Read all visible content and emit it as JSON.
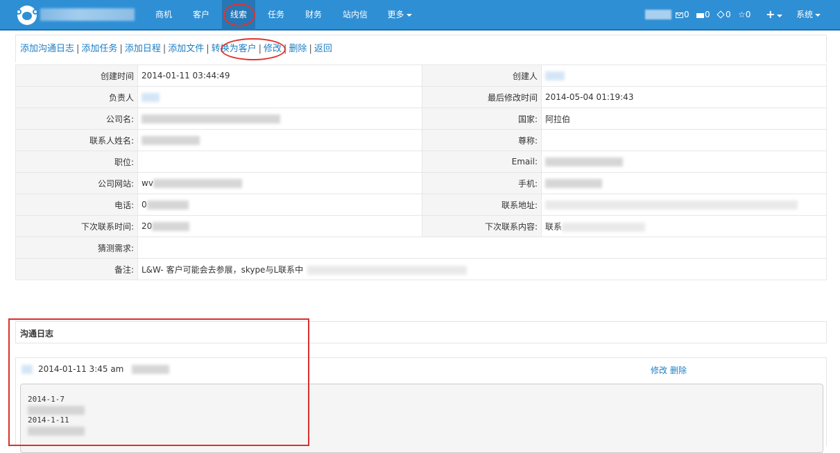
{
  "nav": {
    "items": [
      {
        "label": "商机"
      },
      {
        "label": "客户"
      },
      {
        "label": "线索"
      },
      {
        "label": "任务"
      },
      {
        "label": "财务"
      },
      {
        "label": "站内信"
      },
      {
        "label": "更多"
      }
    ],
    "active": "线索",
    "counts": {
      "messages": "0",
      "cards": "0",
      "tasks": "0",
      "stars": "0"
    },
    "system_label": "系统"
  },
  "actions": [
    {
      "label": "添加沟通日志"
    },
    {
      "label": "添加任务"
    },
    {
      "label": "添加日程"
    },
    {
      "label": "添加文件"
    },
    {
      "label": "转换为客户"
    },
    {
      "label": "修改"
    },
    {
      "label": "删除"
    },
    {
      "label": "返回"
    }
  ],
  "details": {
    "created_time_label": "创建时间",
    "created_time": "2014-01-11 03:44:49",
    "creator_label": "创建人",
    "owner_label": "负责人",
    "last_modified_label": "最后修改时间",
    "last_modified": "2014-05-04 01:19:43",
    "company_label": "公司名:",
    "country_label": "国家:",
    "country": "阿拉伯",
    "contact_name_label": "联系人姓名:",
    "salutation_label": "尊称:",
    "position_label": "职位:",
    "email_label": "Email:",
    "website_label": "公司网站:",
    "website_prefix": "wv",
    "mobile_label": "手机:",
    "phone_label": "电话:",
    "phone_prefix": "0",
    "address_label": "联系地址:",
    "next_contact_time_label": "下次联系时间:",
    "next_contact_time_prefix": "20",
    "next_contact_content_label": "下次联系内容:",
    "next_contact_content_prefix": "联系",
    "guess_need_label": "猜测需求:",
    "remark_label": "备注:",
    "remark": "L&W- 客户可能会去参展，skype与L联系中"
  },
  "log": {
    "title": "沟通日志",
    "entry_time": "2014-01-11 3:45 am",
    "edit_label": "修改",
    "delete_label": "删除",
    "lines": [
      "2014-1-7",
      "2014-1-11"
    ]
  }
}
